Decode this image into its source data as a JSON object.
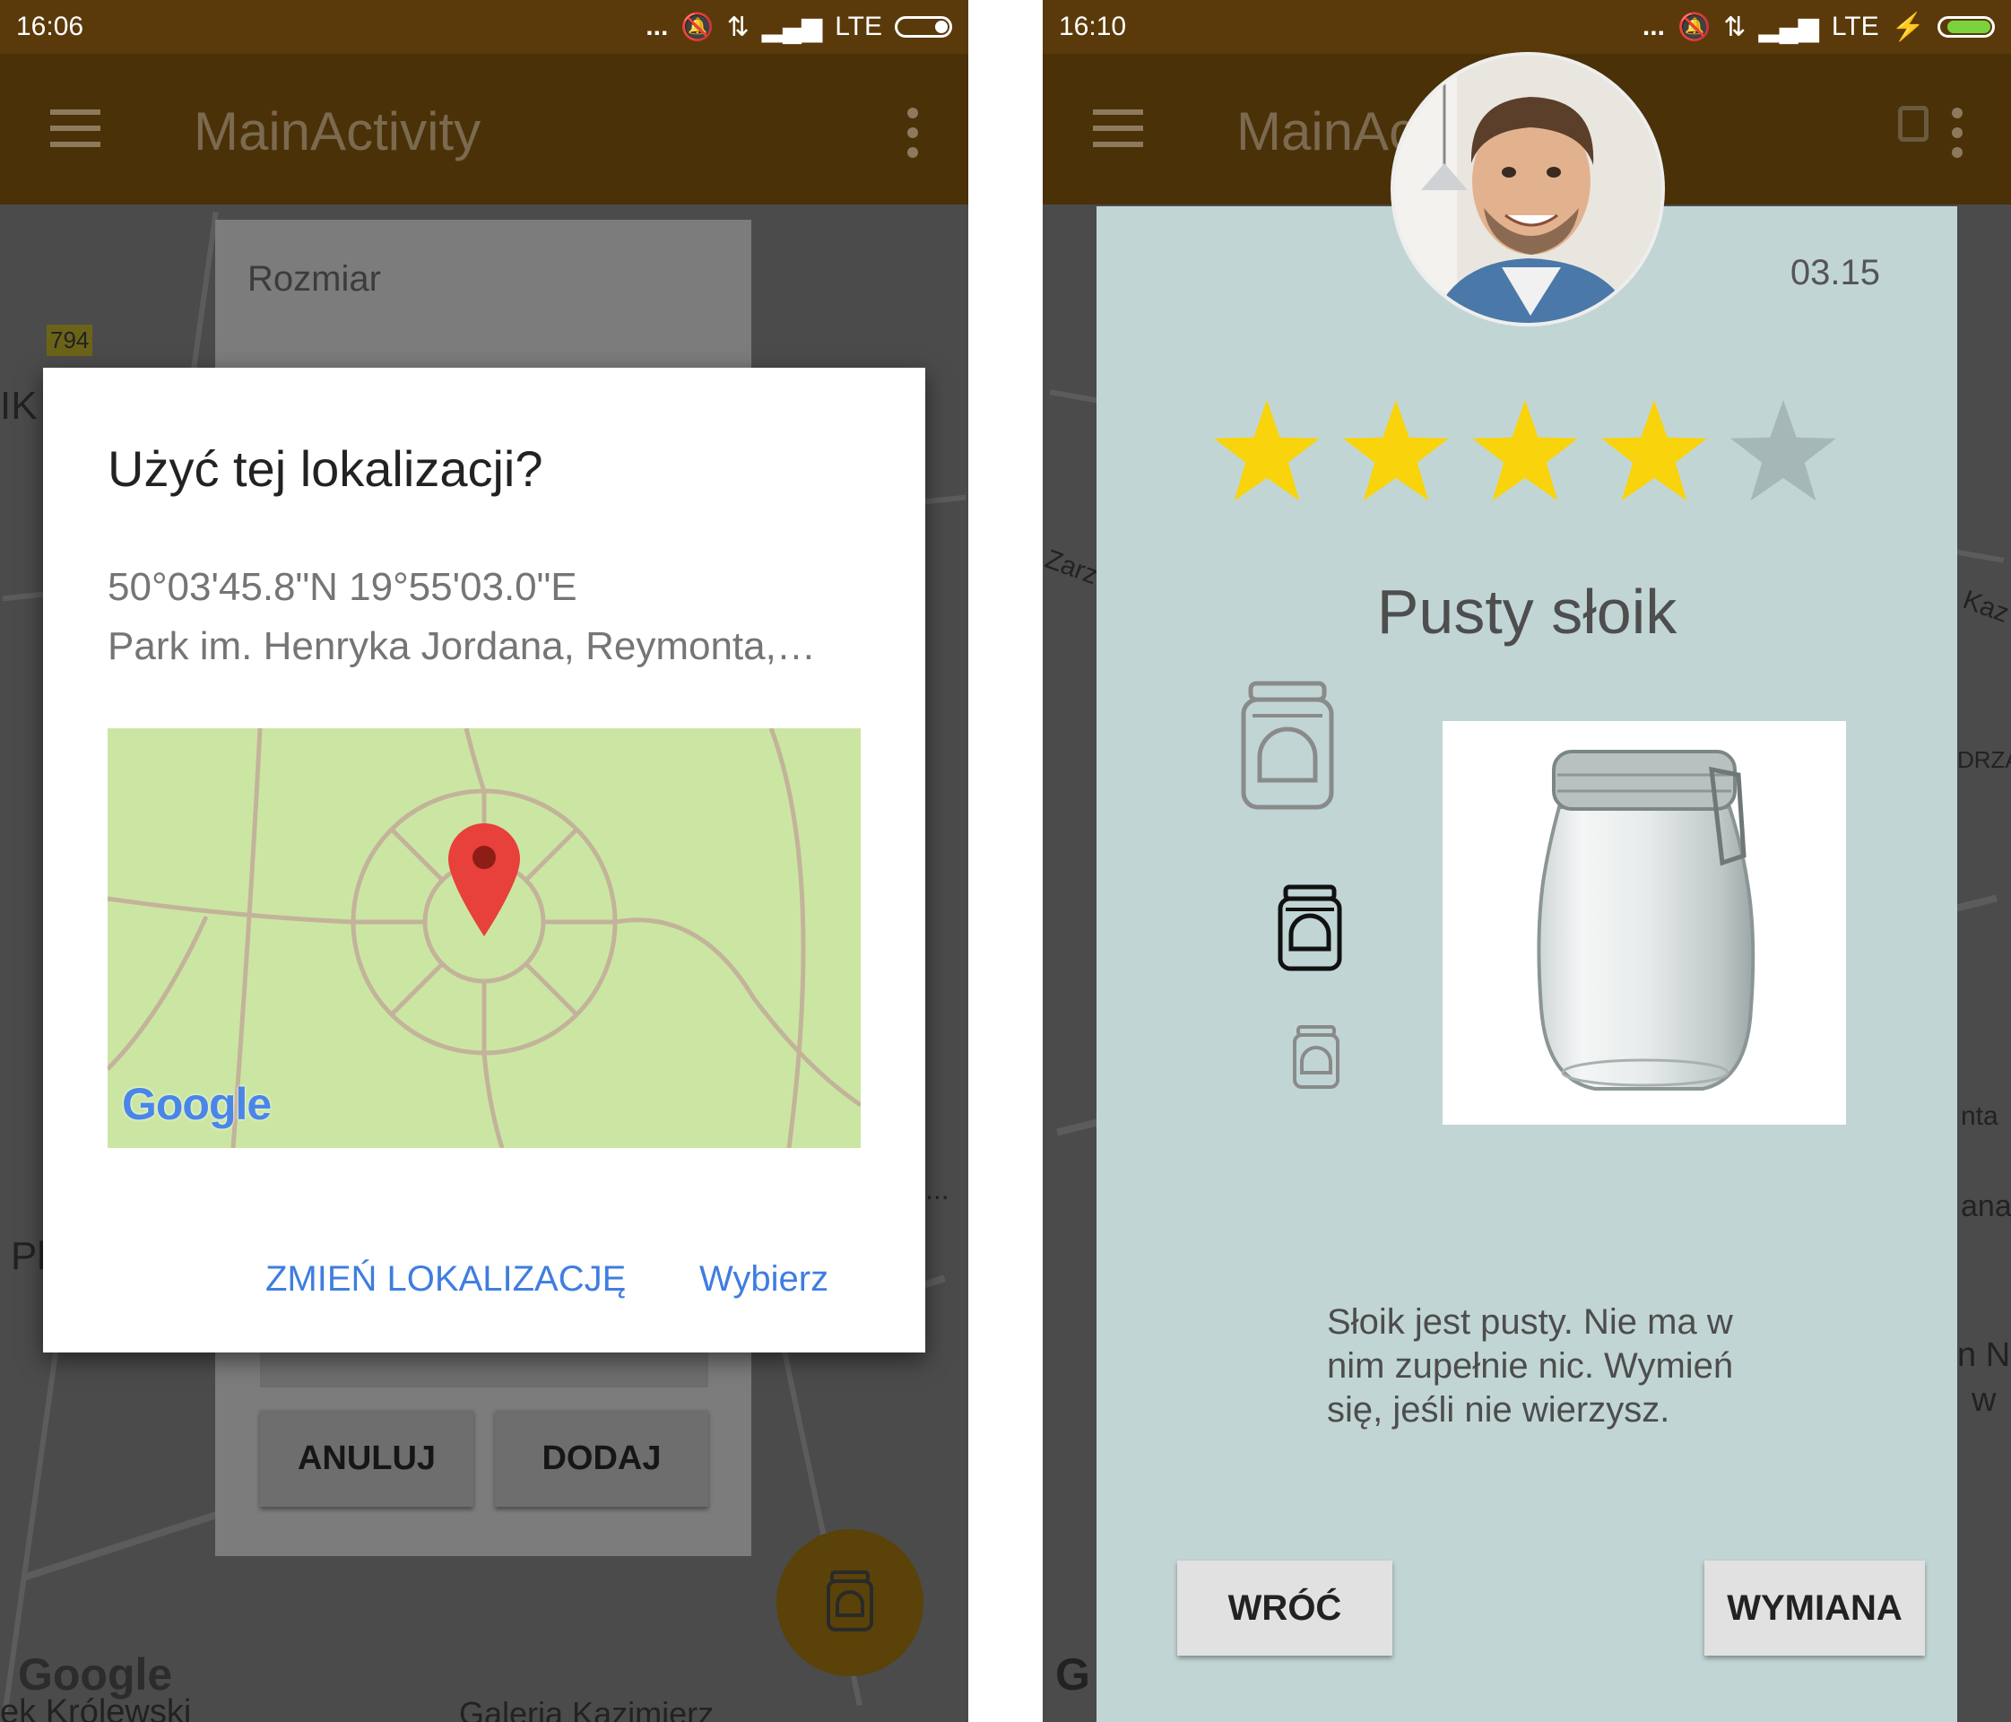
{
  "left": {
    "status": {
      "time": "16:06",
      "dots": "...",
      "network": "LTE"
    },
    "appbar": {
      "title": "MainActivity"
    },
    "map": {
      "label_794": "794",
      "label_ik": "IK",
      "label_pl": "Pl",
      "label_google": "Google",
      "label_street": "ek Królewski",
      "label_gallery": "Galeria Kazimierz",
      "label_ellipsis": "..."
    },
    "form": {
      "size_label": "Rozmiar",
      "cancel": "ANULUJ",
      "add": "DODAJ"
    },
    "dialog": {
      "title": "Użyć tej lokalizacji?",
      "coords": "50°03'45.8\"N 19°55'03.0\"E",
      "address": "Park im. Henryka Jordana, Reymonta,…",
      "map_logo": "Google",
      "change_location": "ZMIEŃ LOKALIZACJĘ",
      "choose": "Wybierz"
    }
  },
  "right": {
    "status": {
      "time": "16:10",
      "dots": "...",
      "network": "LTE"
    },
    "appbar": {
      "title": "MainAc"
    },
    "map": {
      "label_zarz": "Zarz",
      "label_kaz": "Kaz",
      "label_drza": "DRZA",
      "label_nta": "nta",
      "label_ana": "ana",
      "label_nn": "n N",
      "label_w": "w",
      "label_g": "G"
    },
    "offer": {
      "date": "03.15",
      "rating": 4,
      "rating_max": 5,
      "title": "Pusty słoik",
      "description": "Słoik jest pusty. Nie ma w nim zupełnie nic. Wymień się, jeśli nie wierzysz.",
      "back": "WRÓĆ",
      "exchange": "WYMIANA"
    }
  },
  "colors": {
    "status_bar": "#5a3a0a",
    "app_bar_dim": "#4a3108",
    "card": "#c1d6d4",
    "star_on": "#f9d30c",
    "star_off": "#a5b8b5",
    "dialog_link": "#3f7de0"
  },
  "icons": [
    "menu-icon",
    "more-vert-icon",
    "location-pin-icon",
    "jar-icon",
    "bus-icon",
    "star-icon"
  ]
}
